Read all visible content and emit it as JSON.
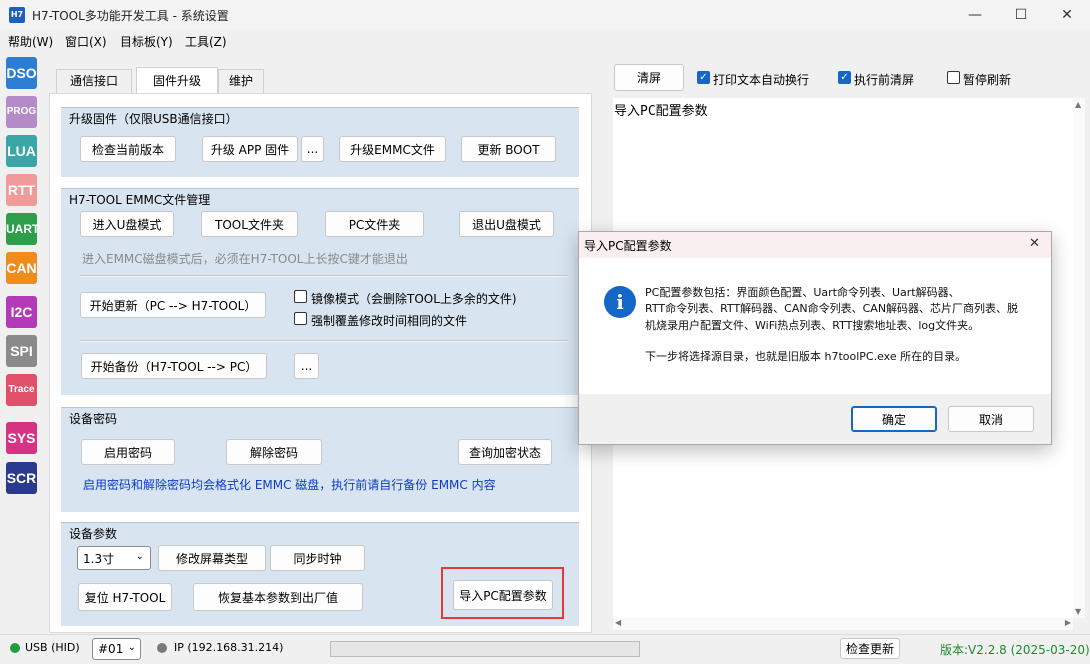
{
  "titlebar": {
    "app_icon": "H7",
    "title": "H7-TOOL多功能开发工具 - 系统设置",
    "minimize": "—",
    "maximize": "☐",
    "close": "✕"
  },
  "menu": [
    "帮助(W)",
    "窗口(X)",
    "目标板(Y)",
    "工具(Z)"
  ],
  "sidebar": [
    {
      "label": "DSO",
      "color": "#2d7dd2"
    },
    {
      "label": "PROG",
      "color": "#b58ac9"
    },
    {
      "label": "LUA",
      "color": "#3aa6a6"
    },
    {
      "label": "RTT",
      "color": "#f09a9a"
    },
    {
      "label": "UART",
      "color": "#2e9e4a"
    },
    {
      "label": "CAN",
      "color": "#f08c1c"
    },
    {
      "label": "I2C",
      "color": "#b43bb8"
    },
    {
      "label": "SPI",
      "color": "#8a8a8a"
    },
    {
      "label": "Trace",
      "color": "#e0506b"
    },
    {
      "label": "SYS",
      "color": "#d63384"
    },
    {
      "label": "SCR",
      "color": "#2b3a8f"
    }
  ],
  "tabs": [
    "通信接口",
    "固件升级",
    "维护"
  ],
  "upgrade": {
    "title": "升级固件（仅限USB通信接口）",
    "check_version": "检查当前版本",
    "upgrade_app": "升级 APP 固件",
    "more": "...",
    "upgrade_emmc": "升级EMMC文件",
    "update_boot": "更新 BOOT"
  },
  "emmc": {
    "title": "H7-TOOL EMMC文件管理",
    "enter_udisk": "进入U盘模式",
    "tool_folder": "TOOL文件夹",
    "pc_folder": "PC文件夹",
    "exit_udisk": "退出U盘模式",
    "hint": "进入EMMC磁盘模式后，必须在H7-TOOL上长按C键才能退出",
    "start_update": "开始更新（PC --> H7-TOOL）",
    "mirror_mode": "镜像模式（会删除TOOL上多余的文件)",
    "force_overwrite": "强制覆盖修改时间相同的文件",
    "start_backup": "开始备份（H7-TOOL --> PC）",
    "more": "..."
  },
  "password": {
    "title": "设备密码",
    "enable": "启用密码",
    "disable": "解除密码",
    "query": "查询加密状态",
    "note": "启用密码和解除密码均会格式化 EMMC 磁盘，执行前请自行备份 EMMC 内容"
  },
  "device": {
    "title": "设备参数",
    "screen_size": "1.3寸",
    "modify_screen": "修改屏幕类型",
    "sync_clock": "同步时钟",
    "reset": "复位 H7-TOOL",
    "restore": "恢复基本参数到出厂值",
    "import_pc": "导入PC配置参数"
  },
  "output": {
    "clear": "清屏",
    "auto_wrap": "打印文本自动换行",
    "clear_before": "执行前清屏",
    "pause": "暂停刷新",
    "text": "导入PC配置参数"
  },
  "dialog": {
    "title": "导入PC配置参数",
    "icon": "info-icon",
    "lines": [
      "PC配置参数包括：界面颜色配置、Uart命令列表、Uart解码器、",
      "RTT命令列表、RTT解码器、CAN命令列表、CAN解码器、芯片厂商列表、脱",
      "机烧录用户配置文件、WiFi热点列表、RTT搜索地址表、log文件夹。"
    ],
    "line2": "下一步将选择源目录，也就是旧版本 h7toolPC.exe 所在的目录。",
    "ok": "确定",
    "cancel": "取消",
    "close": "✕"
  },
  "status": {
    "usb": "USB (HID)",
    "device_no": "#01",
    "ip": "IP (192.168.31.214)",
    "check_update": "检查更新",
    "version": "版本:V2.2.8 (2025-03-20)"
  }
}
